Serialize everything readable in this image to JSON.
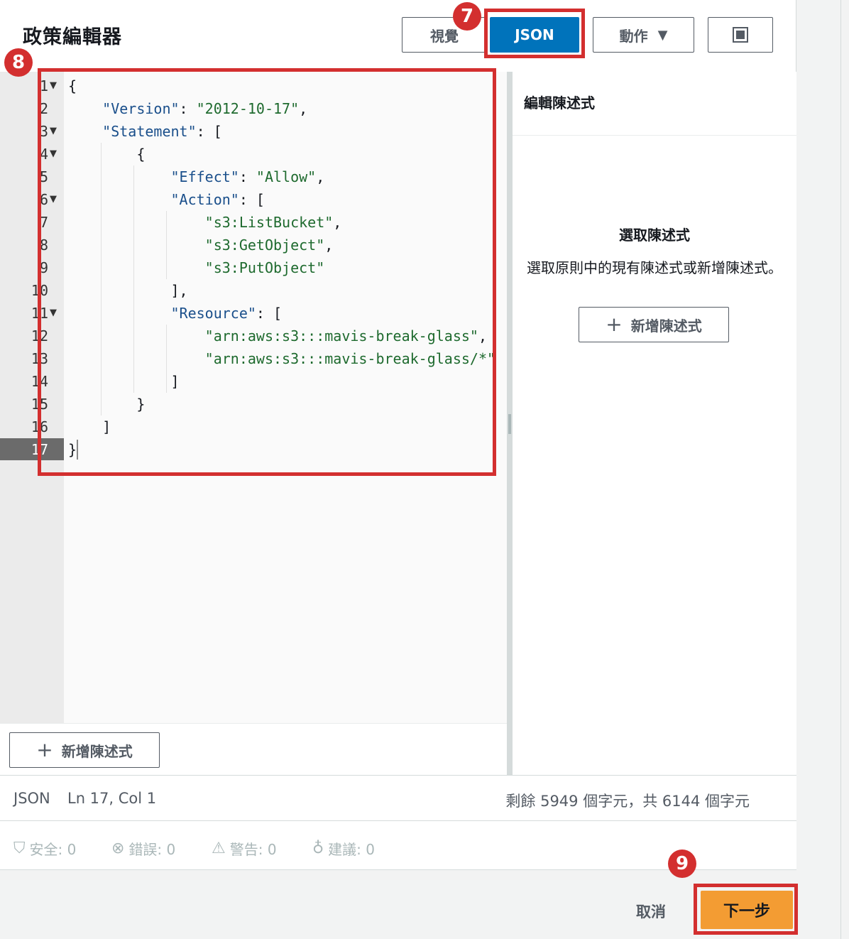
{
  "header": {
    "title": "政策編輯器",
    "tabs": {
      "visual": "視覺",
      "json": "JSON"
    },
    "actions_label": "動作",
    "actions_caret": "▼"
  },
  "markers": {
    "m7": "7",
    "m8": "8",
    "m9": "9"
  },
  "editor": {
    "line_numbers": [
      "1",
      "2",
      "3",
      "4",
      "5",
      "6",
      "7",
      "8",
      "9",
      "10",
      "11",
      "12",
      "13",
      "14",
      "15",
      "16",
      "17"
    ],
    "lines": [
      [
        "{"
      ],
      [
        "    ",
        "\"Version\"",
        ": ",
        "\"2012-10-17\"",
        ","
      ],
      [
        "    ",
        "\"Statement\"",
        ": ["
      ],
      [
        "        {"
      ],
      [
        "            ",
        "\"Effect\"",
        ": ",
        "\"Allow\"",
        ","
      ],
      [
        "            ",
        "\"Action\"",
        ": ["
      ],
      [
        "                ",
        "",
        "",
        "\"s3:ListBucket\"",
        ","
      ],
      [
        "                ",
        "",
        "",
        "\"s3:GetObject\"",
        ","
      ],
      [
        "                ",
        "",
        "",
        "\"s3:PutObject\"",
        ""
      ],
      [
        "            ],"
      ],
      [
        "            ",
        "\"Resource\"",
        ": ["
      ],
      [
        "                ",
        "",
        "",
        "\"arn:aws:s3:::mavis-break-glass\"",
        ","
      ],
      [
        "                ",
        "",
        "",
        "\"arn:aws:s3:::mavis-break-glass/*\"",
        ""
      ],
      [
        "            ]"
      ],
      [
        "        }"
      ],
      [
        "    ]"
      ],
      [
        "}"
      ]
    ],
    "add_statement_label": "新增陳述式"
  },
  "side_panel": {
    "title": "編輯陳述式",
    "empty_title": "選取陳述式",
    "empty_desc": "選取原則中的現有陳述式或新增陳述式。",
    "add_label": "新增陳述式"
  },
  "status": {
    "language": "JSON",
    "position": "Ln 17, Col 1",
    "chars": "剩餘 5949 個字元，共 6144 個字元"
  },
  "checks": {
    "security": "安全: 0",
    "errors": "錯誤: 0",
    "warnings": "警告: 0",
    "suggestions": "建議: 0"
  },
  "footer": {
    "cancel": "取消",
    "next": "下一步"
  },
  "colors": {
    "primary": "#0073bb",
    "next_button": "#f39c33",
    "highlight": "#d32f2f",
    "json_key": "#1a4f8b",
    "json_string": "#1e6a2e"
  }
}
